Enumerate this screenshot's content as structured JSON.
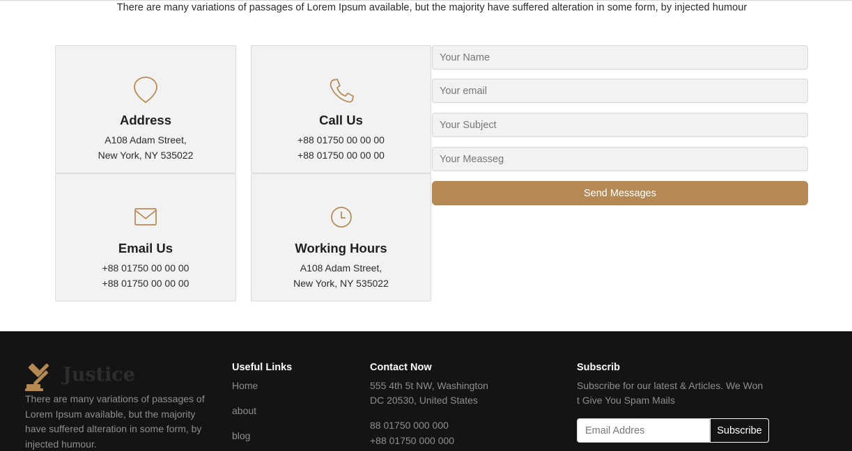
{
  "intro_text": "There are many variations of passages of Lorem Ipsum available, but the majority have suffered alteration in some form, by injected humour",
  "accent_color": "#b48954",
  "cards": [
    {
      "icon": "map-pin-icon",
      "title": "Address",
      "line1": "A108 Adam Street,",
      "line2": "New York, NY 535022"
    },
    {
      "icon": "phone-icon",
      "title": "Call Us",
      "line1": "+88 01750 00 00 00",
      "line2": "+88 01750 00 00 00"
    },
    {
      "icon": "envelope-icon",
      "title": "Email Us",
      "line1": "+88 01750 00 00 00",
      "line2": "+88 01750 00 00 00"
    },
    {
      "icon": "clock-icon",
      "title": "Working Hours",
      "line1": "A108 Adam Street,",
      "line2": "New York, NY 535022"
    }
  ],
  "form": {
    "name_placeholder": "Your Name",
    "email_placeholder": "Your email",
    "subject_placeholder": "Your Subject",
    "message_placeholder": "Your Measseg",
    "send_label": "Send Messages"
  },
  "footer": {
    "brand_name": "Justice",
    "brand_icon": "gavel-icon",
    "about_text": "There are many variations of passages of Lorem Ipsum available, but the majority have suffered alteration in some form, by injected humour.",
    "useful_links": {
      "title": "Useful Links",
      "items": [
        "Home",
        "about",
        "blog"
      ]
    },
    "contact": {
      "title": "Contact Now",
      "address_line1": "555 4th 5t NW, Washington",
      "address_line2": "DC 20530, United States",
      "phone1": "88 01750 000 000",
      "phone2": "+88 01750 000 000"
    },
    "subscribe": {
      "title": "Subscrib",
      "text_line1": "Subscribe for our latest & Articles. We Won",
      "text_line2": "t Give You Spam Mails",
      "input_placeholder": "Email Addres",
      "button_label": "Subscribe"
    }
  }
}
